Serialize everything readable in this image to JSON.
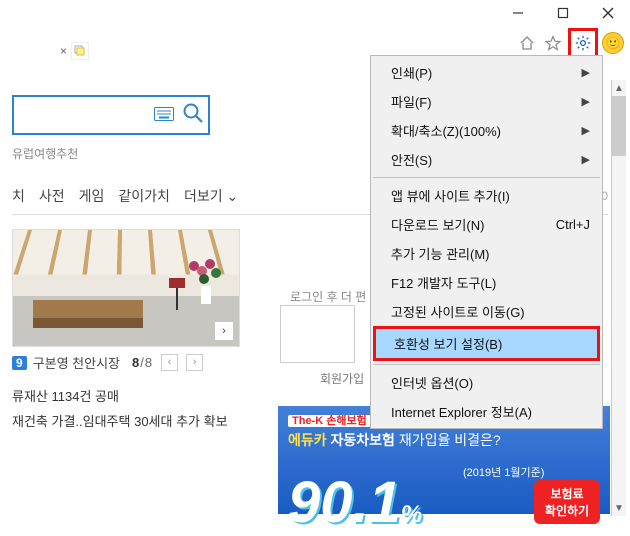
{
  "window": {
    "minimize": "",
    "maximize": "",
    "close": ""
  },
  "tabs_area": {
    "close": "×"
  },
  "toolbar": {
    "home": "home",
    "favorites": "star",
    "gear": "gear",
    "smile": "🙂"
  },
  "search": {
    "suggest": "유럽여행추천"
  },
  "nav": {
    "items": [
      "치",
      "사전",
      "게임",
      "같이가치",
      "더보기"
    ],
    "num": "0"
  },
  "headline": {
    "category": "9",
    "title": "구본영 천안시장",
    "page_cur": "8",
    "page_total": "8"
  },
  "news": [
    "류재산 1134건 공매",
    "재건축 가결..임대주택 30세대 추가 확보"
  ],
  "login": {
    "prompt": "로그인 후 더 편",
    "signup": "회원가입"
  },
  "banner": {
    "thek": "The-K 손해보험",
    "yellow": "에듀카",
    "car": " 자동차보험",
    "rest": " 재가입율 비결은?",
    "big": "90.1",
    "dates": "(2019년 1월기준)",
    "badge1": "보험료",
    "badge2": "확인하기"
  },
  "menu": {
    "print": "인쇄(P)",
    "file": "파일(F)",
    "zoom": "확대/축소(Z)(100%)",
    "safety": "안전(S)",
    "appview": "앱 뷰에 사이트 추가(I)",
    "downloads": "다운로드 보기(N)",
    "downloads_sc": "Ctrl+J",
    "addons": "추가 기능 관리(M)",
    "f12": "F12 개발자 도구(L)",
    "pinned": "고정된 사이트로 이동(G)",
    "compat": "호환성 보기 설정(B)",
    "inet": "인터넷 옵션(O)",
    "about": "Internet Explorer 정보(A)"
  }
}
